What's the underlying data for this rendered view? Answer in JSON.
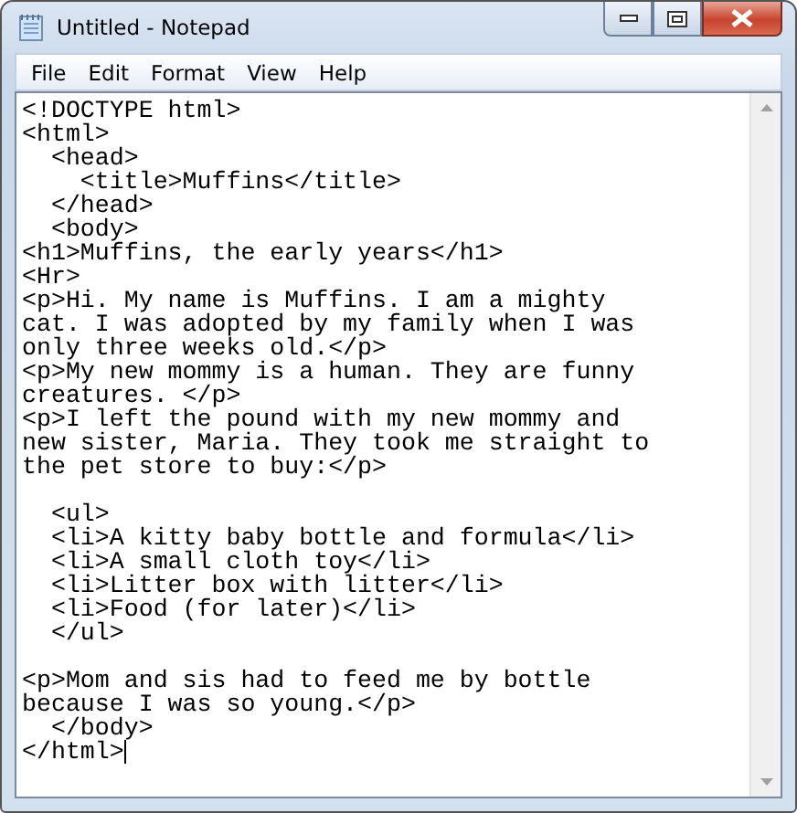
{
  "window": {
    "title": "Untitled - Notepad"
  },
  "menu": [
    "File",
    "Edit",
    "Format",
    "View",
    "Help"
  ],
  "editor": {
    "caret": true,
    "blocks": [
      {
        "lines": [
          "<!DOCTYPE html>",
          "<html>",
          "  <head>",
          "    <title>Muffins</title>",
          "  </head>",
          "  <body>",
          "<h1>Muffins, the early years</h1>",
          "<Hr>",
          "<p>Hi. My name is Muffins. I am a mighty",
          "cat. I was adopted by my family when I was",
          "only three weeks old.</p>",
          "<p>My new mommy is a human. They are funny",
          "creatures. </p>",
          "<p>I left the pound with my new mommy and",
          "new sister, Maria. They took me straight to",
          "the pet store to buy:</p>"
        ]
      },
      {
        "lines": [
          "  <ul>",
          "  <li>A kitty baby bottle and formula</li>",
          "  <li>A small cloth toy</li>",
          "  <li>Litter box with litter</li>",
          "  <li>Food (for later)</li>",
          "  </ul>"
        ]
      },
      {
        "lines": [
          "<p>Mom and sis had to feed me by bottle",
          "because I was so young.</p>",
          "  </body>",
          "</html>"
        ]
      }
    ]
  }
}
